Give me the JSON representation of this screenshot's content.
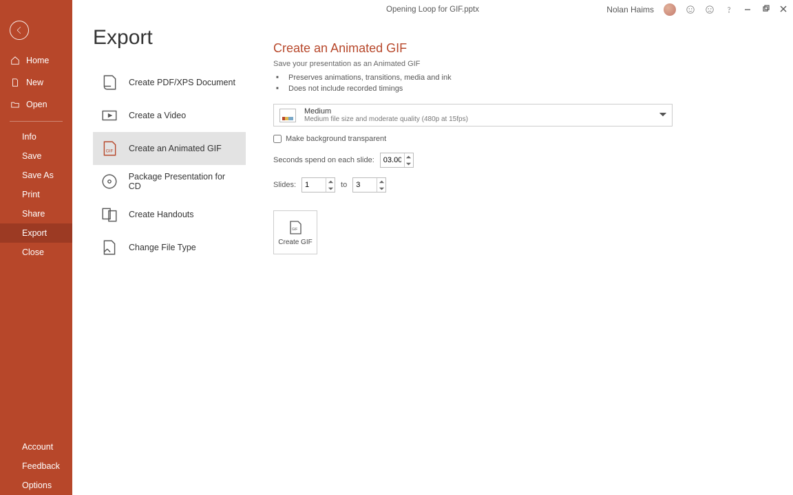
{
  "titlebar": {
    "filename": "Opening Loop for GIF.pptx",
    "username": "Nolan Haims"
  },
  "sidebar": {
    "home": "Home",
    "new": "New",
    "open": "Open",
    "info": "Info",
    "save": "Save",
    "save_as": "Save As",
    "print": "Print",
    "share": "Share",
    "export": "Export",
    "close": "Close",
    "account": "Account",
    "feedback": "Feedback",
    "options": "Options"
  },
  "export": {
    "title": "Export",
    "options": {
      "pdf": "Create PDF/XPS Document",
      "video": "Create a Video",
      "gif": "Create an Animated GIF",
      "cd": "Package Presentation for CD",
      "handouts": "Create Handouts",
      "filetype": "Change File Type"
    }
  },
  "detail": {
    "heading": "Create an Animated GIF",
    "sub": "Save your presentation as an Animated GIF",
    "bullet1": "Preserves animations, transitions, media and ink",
    "bullet2": "Does not include recorded timings",
    "quality_name": "Medium",
    "quality_desc": "Medium file size and moderate quality (480p at 15fps)",
    "transparent_label": "Make background transparent",
    "seconds_label": "Seconds spend on each slide:",
    "seconds_value": "03.00",
    "slides_label": "Slides:",
    "slides_from": "1",
    "slides_to_label": "to",
    "slides_to": "3",
    "create_btn": "Create GIF"
  }
}
